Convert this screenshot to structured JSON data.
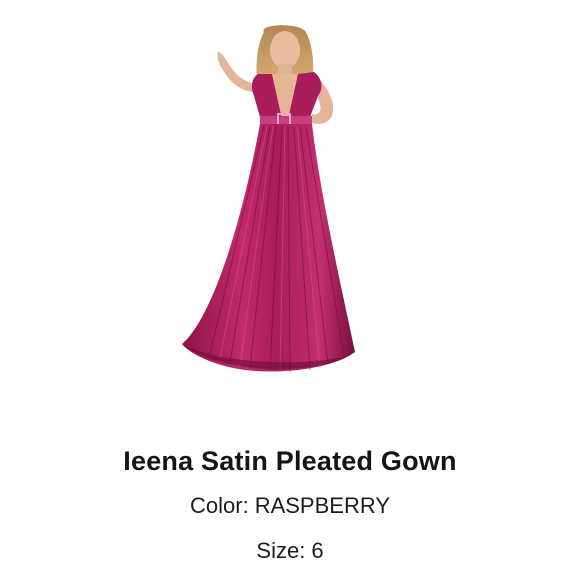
{
  "product": {
    "title": "Ieena Satin Pleated Gown",
    "color_label": "Color:",
    "color_value": "RASPBERRY",
    "size_label": "Size:",
    "size_value": "6"
  },
  "colors": {
    "gown": "#b0205e",
    "gown_shadow": "#7d0f3f",
    "gown_highlight": "#d4488a",
    "skin": "#e8b89a",
    "hair": "#c89a5e"
  }
}
